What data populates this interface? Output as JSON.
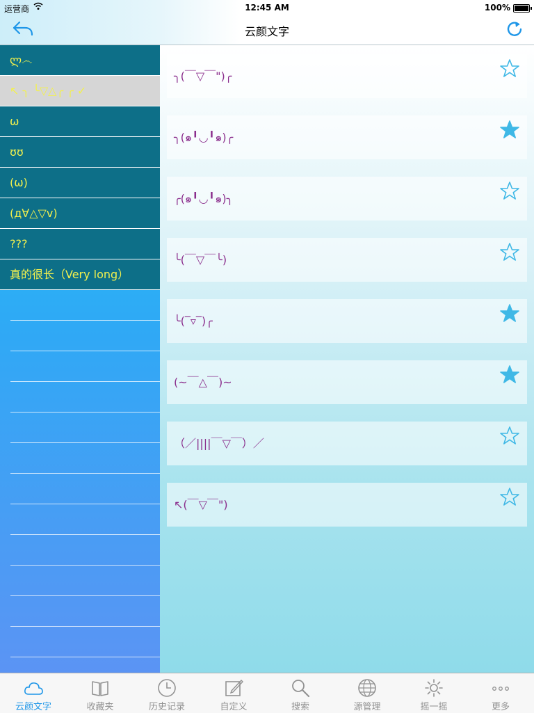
{
  "status": {
    "carrier": "运营商",
    "time": "12:45 AM",
    "battery": "100%"
  },
  "nav": {
    "title": "云颜文字"
  },
  "sidebar": {
    "items": [
      {
        "label": "ლ෴",
        "selected": false
      },
      {
        "label": "↖ ╮ ╰▽△╭ ╭ ✓",
        "selected": true
      },
      {
        "label": "ω",
        "selected": false
      },
      {
        "label": "ʊʊ",
        "selected": false
      },
      {
        "label": "(ω)",
        "selected": false
      },
      {
        "label": "(д∀△▽v)",
        "selected": false
      },
      {
        "label": "???",
        "selected": false
      },
      {
        "label": "真的很长（Very long）",
        "selected": false
      }
    ],
    "empty_rows": 13
  },
  "entries": [
    {
      "text": "╮(￣▽￣\")╭",
      "favorited": false
    },
    {
      "text": "╮(๑╹◡╹๑)╭",
      "favorited": true
    },
    {
      "text": "╭(๑╹◡╹๑)╮",
      "favorited": false
    },
    {
      "text": "╰(￣▽￣╰)",
      "favorited": false
    },
    {
      "text": "╰(‾▿‾)╭",
      "favorited": true
    },
    {
      "text": "(~￣△￣)~",
      "favorited": true
    },
    {
      "text": "（／||||￣▽￣）／",
      "favorited": false
    },
    {
      "text": "↖(￣▽￣\")",
      "favorited": false
    }
  ],
  "tabs": [
    {
      "label": "云颜文字",
      "icon": "cloud-icon",
      "active": true
    },
    {
      "label": "收藏夹",
      "icon": "book-icon",
      "active": false
    },
    {
      "label": "历史记录",
      "icon": "clock-icon",
      "active": false
    },
    {
      "label": "自定义",
      "icon": "edit-icon",
      "active": false
    },
    {
      "label": "搜索",
      "icon": "search-icon",
      "active": false
    },
    {
      "label": "源管理",
      "icon": "globe-icon",
      "active": false
    },
    {
      "label": "摇一摇",
      "icon": "sun-icon",
      "active": false
    },
    {
      "label": "更多",
      "icon": "more-icon",
      "active": false
    }
  ],
  "colors": {
    "accent": "#1e96e8",
    "star": "#3fb8e6",
    "kaomoji": "#8a2d8c",
    "sidebar_text": "#f3f14d"
  }
}
